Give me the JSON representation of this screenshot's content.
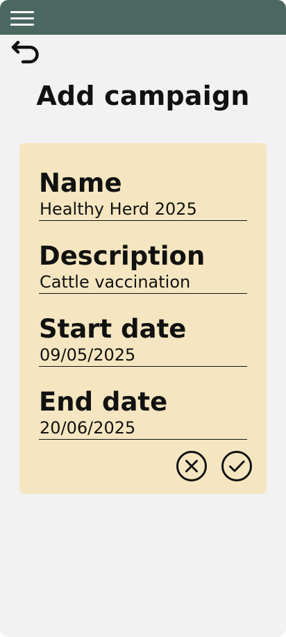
{
  "header": {
    "menu_icon": "hamburger-menu-icon"
  },
  "nav": {
    "back_icon": "undo-arrow-icon"
  },
  "page": {
    "title": "Add campaign"
  },
  "form": {
    "fields": [
      {
        "label": "Name",
        "value": "Healthy Herd 2025"
      },
      {
        "label": "Description",
        "value": "Cattle vaccination"
      },
      {
        "label": "Start date",
        "value": "09/05/2025"
      },
      {
        "label": "End date",
        "value": "20/06/2025"
      }
    ],
    "actions": {
      "cancel_icon": "close-circle-icon",
      "confirm_icon": "check-circle-icon"
    }
  },
  "colors": {
    "topbar": "#4a6760",
    "background": "#f2f2f2",
    "card": "#f5e6c1",
    "text": "#111111"
  }
}
